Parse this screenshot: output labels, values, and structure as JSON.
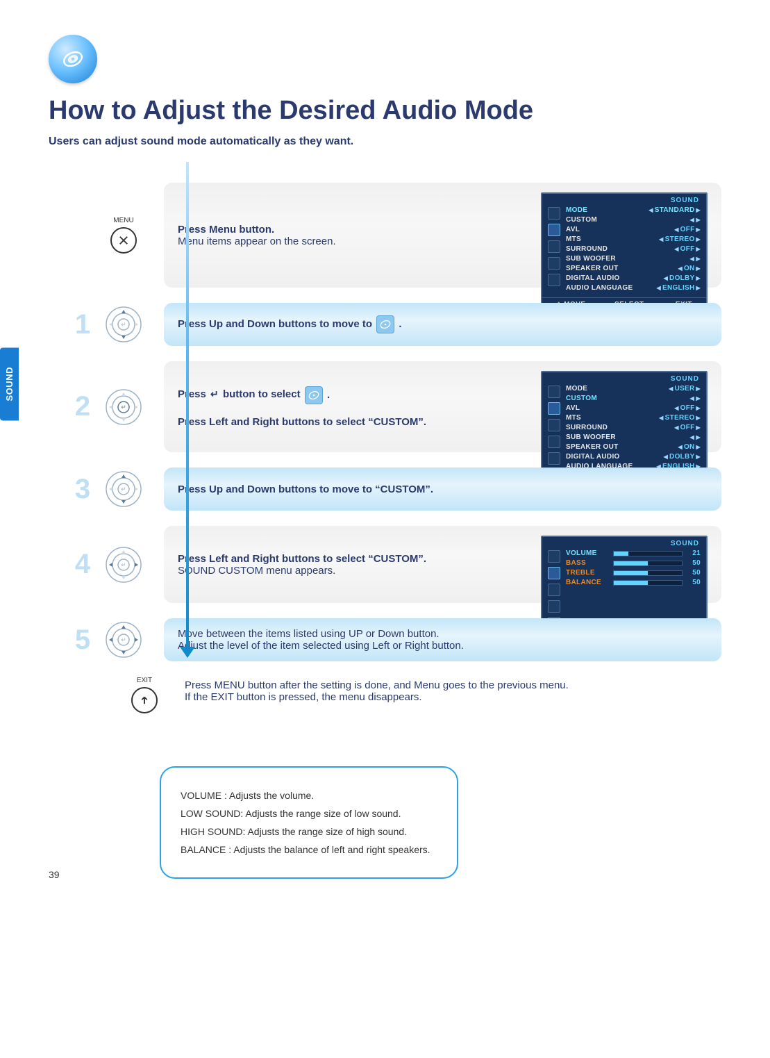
{
  "side_tab": "SOUND",
  "title": "How to Adjust the Desired Audio Mode",
  "subtitle": "Users can adjust sound mode automatically as they want.",
  "menu_label": "MENU",
  "exit_label": "EXIT",
  "page_number": "39",
  "steps": {
    "menu": {
      "line1": "Press Menu button.",
      "line2": "Menu items appear on the screen."
    },
    "s1": {
      "num": "1",
      "text_a": "Press Up and Down buttons to move to ",
      "text_b": "."
    },
    "s2": {
      "num": "2",
      "text_a": "Press ",
      "enter": "↵",
      "text_b": " button to select ",
      "text_c": ".",
      "text_d": "Press Left and Right buttons to select  “CUSTOM”."
    },
    "s3": {
      "num": "3",
      "text": "Press Up and Down buttons to move to  “CUSTOM”."
    },
    "s4": {
      "num": "4",
      "text_a": "Press Left and Right buttons to select  “CUSTOM”.",
      "text_b": "SOUND CUSTOM menu appears."
    },
    "s5": {
      "num": "5",
      "text_a": "Move between the items listed using UP or Down button.",
      "text_b": "Adjust the level of the item selected using Left or Right button."
    },
    "exit": {
      "line1": "Press MENU button after the setting is done, and Menu goes to the previous menu.",
      "line2": "If the EXIT button is pressed, the menu disappears."
    }
  },
  "notes": {
    "n1": "VOLUME : Adjusts the volume.",
    "n2": "LOW SOUND: Adjusts the range size of low sound.",
    "n3": "HIGH SOUND: Adjusts the range size of high sound.",
    "n4": "BALANCE : Adjusts the balance of left and right speakers."
  },
  "osd": {
    "title": "SOUND",
    "foot": {
      "move": "MOVE",
      "select": "SELECT",
      "exit": "EXIT"
    },
    "menu1": {
      "rows": [
        {
          "k": "MODE",
          "v": "STANDARD",
          "hl": true
        },
        {
          "k": "CUSTOM",
          "v": "◀ ▶"
        },
        {
          "k": "AVL",
          "v": "OFF"
        },
        {
          "k": "MTS",
          "v": "STEREO"
        },
        {
          "k": "SURROUND",
          "v": "OFF"
        },
        {
          "k": "SUB WOOFER",
          "v": "◀ ▶"
        },
        {
          "k": "SPEAKER OUT",
          "v": "ON"
        },
        {
          "k": "DIGITAL AUDIO",
          "v": "DOLBY"
        },
        {
          "k": "AUDIO LANGUAGE",
          "v": "ENGLISH"
        }
      ]
    },
    "menu2": {
      "rows": [
        {
          "k": "MODE",
          "v": "USER"
        },
        {
          "k": "CUSTOM",
          "v": "◀ ▶",
          "hl": true
        },
        {
          "k": "AVL",
          "v": "OFF"
        },
        {
          "k": "MTS",
          "v": "STEREO"
        },
        {
          "k": "SURROUND",
          "v": "OFF"
        },
        {
          "k": "SUB WOOFER",
          "v": "◀ ▶"
        },
        {
          "k": "SPEAKER OUT",
          "v": "ON"
        },
        {
          "k": "DIGITAL AUDIO",
          "v": "DOLBY"
        },
        {
          "k": "AUDIO LANGUAGE",
          "v": "ENGLISH"
        }
      ]
    },
    "menu3": {
      "rows": [
        {
          "k": "VOLUME",
          "v": "21",
          "pct": 21,
          "hl": true
        },
        {
          "k": "BASS",
          "v": "50",
          "pct": 50
        },
        {
          "k": "TREBLE",
          "v": "50",
          "pct": 50
        },
        {
          "k": "BALANCE",
          "v": "50",
          "pct": 50
        }
      ]
    }
  }
}
